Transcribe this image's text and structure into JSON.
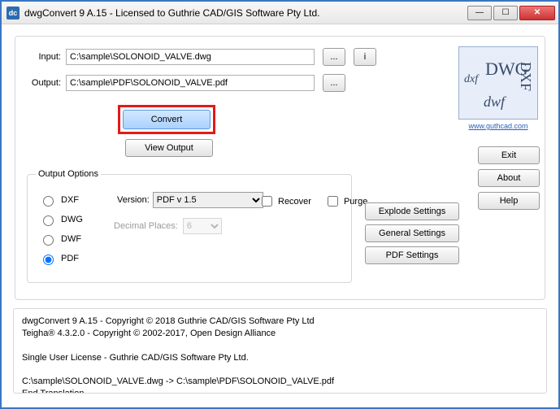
{
  "window": {
    "icon_text": "dc",
    "title": "dwgConvert 9 A.15 - Licensed to Guthrie CAD/GIS Software Pty Ltd."
  },
  "labels": {
    "input": "Input:",
    "output": "Output:",
    "version": "Version:",
    "decimal_places": "Decimal Places:"
  },
  "fields": {
    "input_value": "C:\\sample\\SOLONOID_VALVE.dwg",
    "output_value": "C:\\sample\\PDF\\SOLONOID_VALVE.pdf"
  },
  "buttons": {
    "browse": "...",
    "info": "i",
    "convert": "Convert",
    "view_output": "View Output",
    "exit": "Exit",
    "about": "About",
    "help": "Help",
    "explode_settings": "Explode Settings",
    "general_settings": "General Settings",
    "pdf_settings": "PDF Settings"
  },
  "logo": {
    "dwg": "DWG",
    "dxf_small": "dxf",
    "dxf_caps": "DXF",
    "dwf": "dwf",
    "url": "www.guthcad.com"
  },
  "options": {
    "legend": "Output Options",
    "radios": {
      "dxf": "DXF",
      "dwg": "DWG",
      "dwf": "DWF",
      "pdf": "PDF"
    },
    "selected_radio": "pdf",
    "version_value": "PDF v 1.5",
    "decimal_value": "6",
    "recover": "Recover",
    "purge": "Purge"
  },
  "footer_text": "dwgConvert 9 A.15 - Copyright © 2018 Guthrie CAD/GIS Software Pty Ltd\nTeigha® 4.3.2.0 - Copyright © 2002-2017, Open Design Alliance\n\nSingle User License - Guthrie CAD/GIS Software Pty Ltd.\n\nC:\\sample\\SOLONOID_VALVE.dwg -> C:\\sample\\PDF\\SOLONOID_VALVE.pdf\nEnd Translation."
}
